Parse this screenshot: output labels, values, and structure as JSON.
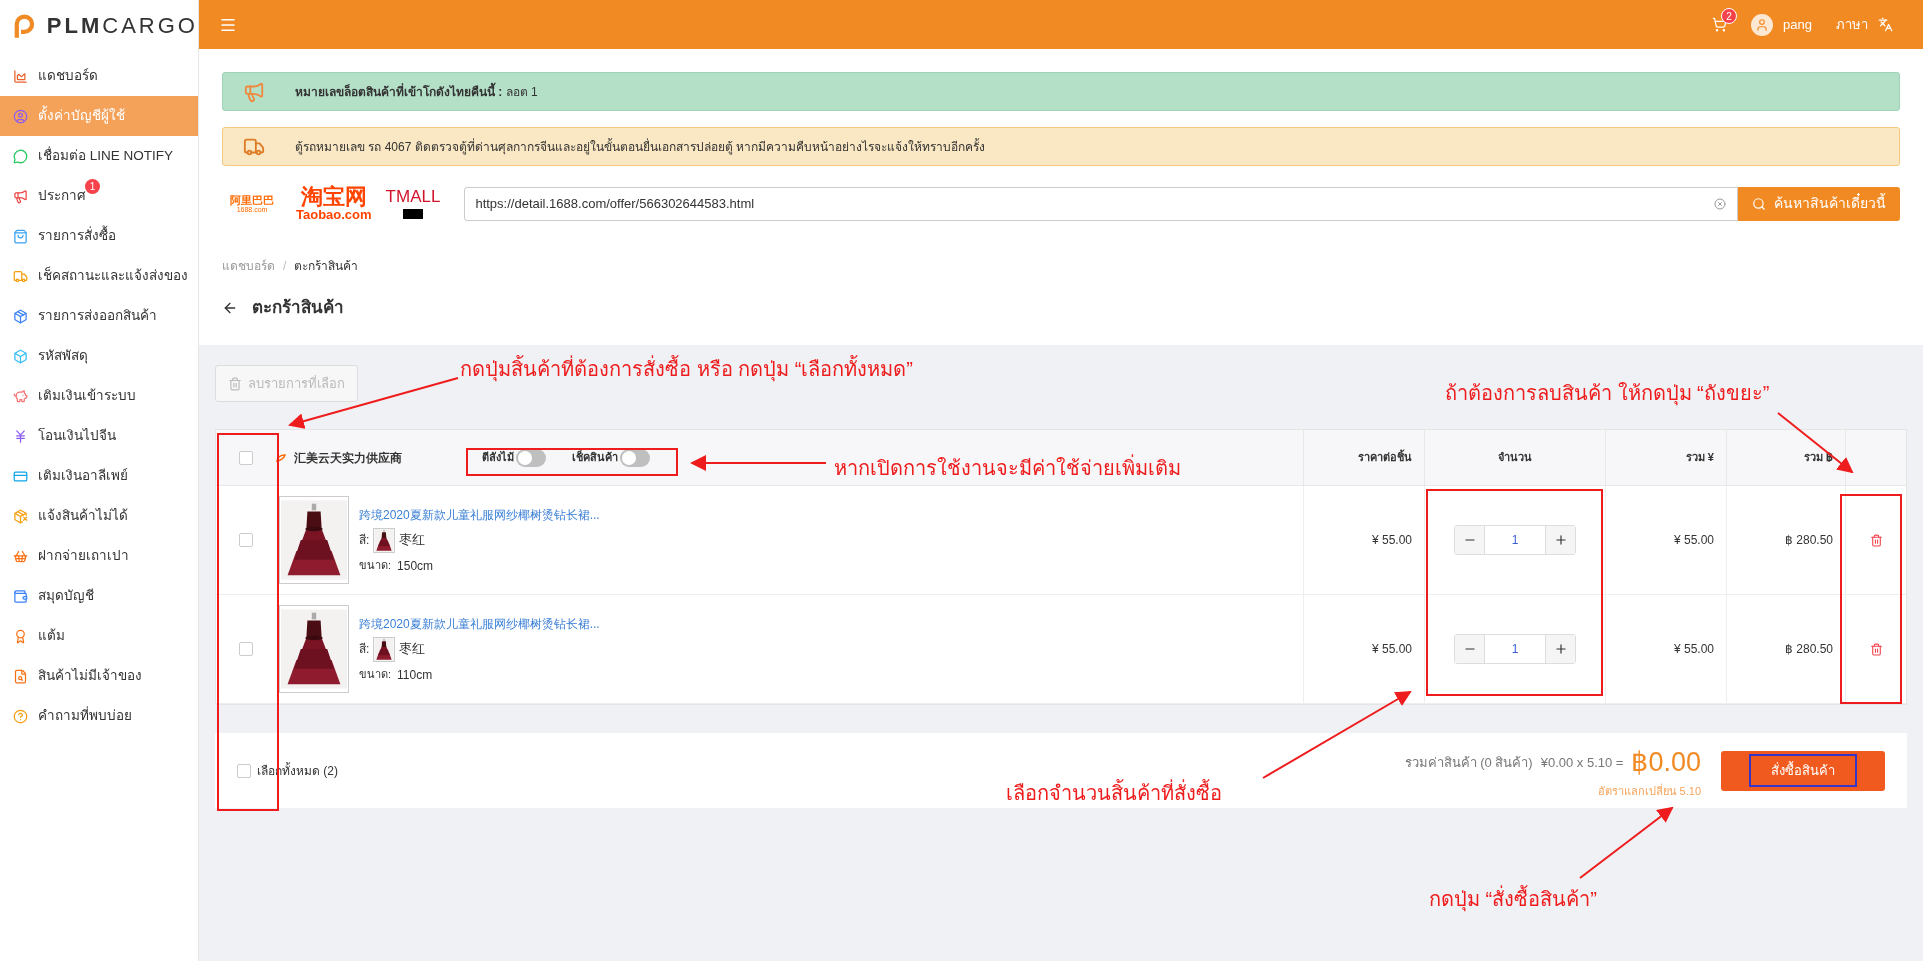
{
  "sidebar": {
    "logo": {
      "strong": "PLM",
      "light": "CARGO"
    },
    "items": [
      {
        "label": "แดชบอร์ด",
        "selected": false
      },
      {
        "label": "ตั้งค่าบัญชีผู้ใช้",
        "selected": true
      },
      {
        "label": "เชื่อมต่อ LINE NOTIFY",
        "selected": false
      },
      {
        "label": "ประกาศ",
        "selected": false,
        "badge": "1"
      },
      {
        "label": "รายการสั่งซื้อ",
        "selected": false
      },
      {
        "label": "เช็คสถานะและแจ้งส่งของ",
        "selected": false
      },
      {
        "label": "รายการส่งออกสินค้า",
        "selected": false
      },
      {
        "label": "รหัสพัสดุ",
        "selected": false
      },
      {
        "label": "เติมเงินเข้าระบบ",
        "selected": false
      },
      {
        "label": "โอนเงินไปจีน",
        "selected": false
      },
      {
        "label": "เติมเงินอาลีเพย์",
        "selected": false
      },
      {
        "label": "แจ้งสินค้าไม่ได้",
        "selected": false
      },
      {
        "label": "ฝากจ่ายเถาเปา",
        "selected": false
      },
      {
        "label": "สมุดบัญชี",
        "selected": false
      },
      {
        "label": "แต้ม",
        "selected": false
      },
      {
        "label": "สินค้าไม่มีเจ้าของ",
        "selected": false
      },
      {
        "label": "คำถามที่พบบ่อย",
        "selected": false
      }
    ]
  },
  "header": {
    "cart_badge": "2",
    "user": "pang",
    "language": "ภาษา"
  },
  "notices": [
    {
      "kind": "announcement",
      "text": "**หมายเลขล็อตสินค้าที่เข้าโกดังไทยคืนนี้ :** ลอต 1"
    },
    {
      "kind": "truck",
      "text": "ตู้รถหมายเลข รถ 4067 ติดตรวจตู้ที่ด่านศุลกากรจีนและอยู่ในขั้นตอนยื่นเอกสารปล่อยตู้ หากมีความคืบหน้าอย่างไรจะแจ้งให้ทราบอีกครั้ง"
    }
  ],
  "search": {
    "logos": {
      "alibaba": "阿里巴巴",
      "alibaba_domain": "1688.com",
      "taobao": "淘宝网",
      "taobao_domain": "Taobao.com",
      "tmall": "TMALL"
    },
    "value": "https://detail.1688.com/offer/566302644583.html",
    "button": "ค้นหาสินค้าเดี๋ยวนี้"
  },
  "breadcrumb": [
    {
      "label": "แดชบอร์ด"
    },
    {
      "label": "ตะกร้าสินค้า"
    }
  ],
  "breadcrumb_separator": "/",
  "title": "ตะกร้าสินค้า",
  "cart": {
    "delete_selected": {
      "label": "ลบรายการที่เลือก",
      "disabled": true
    },
    "header_checked": false,
    "shop": "汇美云天实力供应商",
    "toggles": [
      {
        "label": "ตีลังไม้",
        "on": false
      },
      {
        "label": "เช็คสินค้า",
        "on": false
      }
    ],
    "columns": [
      "ราคาต่อชิ้น",
      "จำนวน",
      "รวม ¥",
      "รวม ฿"
    ],
    "rows": [
      {
        "checked": false,
        "title": "跨境2020夏新款儿童礼服网纱椰树烫钻长裙...",
        "color_label": "สี:",
        "color_name": "枣红",
        "size_label": "ขนาด:",
        "size": "150cm",
        "unit_price": "¥ 55.00",
        "quantity": "1",
        "total_yuan": "¥ 55.00",
        "total_baht": "฿ 280.50"
      },
      {
        "checked": false,
        "title": "跨境2020夏新款儿童礼服网纱椰树烫钻长裙...",
        "color_label": "สี:",
        "color_name": "枣红",
        "size_label": "ขนาด:",
        "size": "110cm",
        "unit_price": "¥ 55.00",
        "quantity": "1",
        "total_yuan": "¥ 55.00",
        "total_baht": "฿ 280.50"
      }
    ],
    "footer": {
      "select_all": "เลือกทั้งหมด (2)",
      "checked": false,
      "summary": "รวมค่าสินค้า (0 สินค้า)",
      "formula": "¥0.00 x 5.10 =",
      "total": "฿0.00",
      "rate": "อัตราแลกเปลี่ยน 5.10",
      "order_button": "สั่งซื้อสินค้า"
    }
  },
  "annotations": [
    "กดปุ่มสิ้นค้าที่ต้องการสั่งซื้อ หรือ กดปุ่ม “เลือกทั้งหมด”",
    "ถ้าต้องการลบสินค้า ให้กดปุ่ม “ถังขยะ”",
    "หากเปิดการใช้งานจะมีค่าใช้จ่ายเพิ่มเติม",
    "เลือกจำนวนสิ้นค้าที่สั่งซื้อ",
    "กดปุ่ม “สั่งซื้อสินค้า”"
  ]
}
